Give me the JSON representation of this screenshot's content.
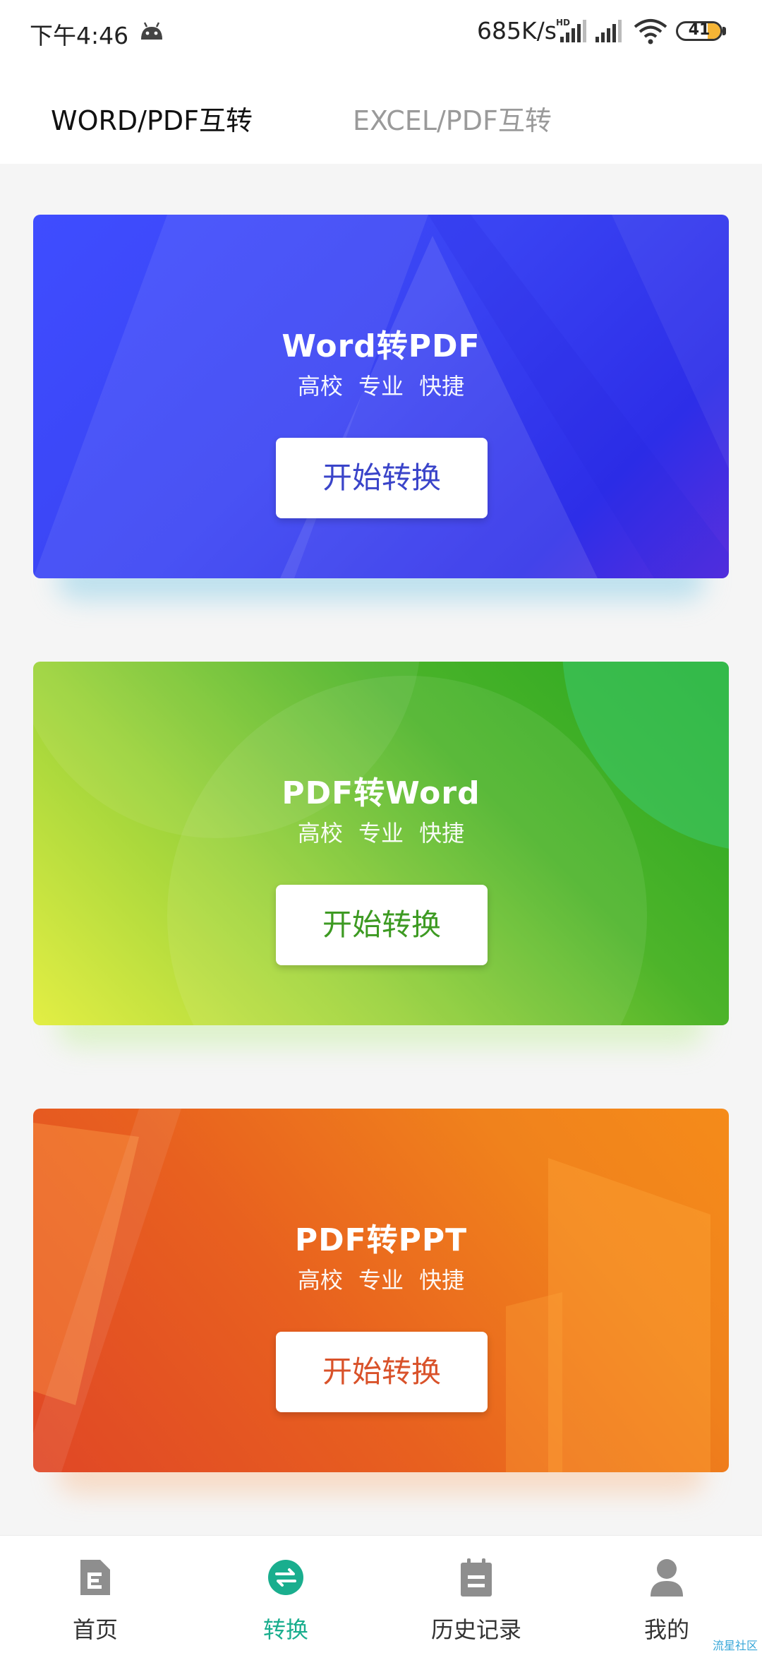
{
  "status_bar": {
    "time": "下午4:46",
    "net_speed": "685K/s",
    "battery": "41",
    "hd_label": "HD"
  },
  "tabs": [
    {
      "label": "WORD/PDF互转",
      "active": true
    },
    {
      "label": "EXCEL/PDF互转",
      "active": false
    }
  ],
  "cards": [
    {
      "title": "Word转PDF",
      "subtitle": "高校 专业 快捷",
      "button": "开始转换",
      "button_color": "#3a44c9"
    },
    {
      "title": "PDF转Word",
      "subtitle": "高校 专业 快捷",
      "button": "开始转换",
      "button_color": "#3d9a22"
    },
    {
      "title": "PDF转PPT",
      "subtitle": "高校 专业 快捷",
      "button": "开始转换",
      "button_color": "#d9522a"
    }
  ],
  "bottom_nav": [
    {
      "label": "首页",
      "icon": "home-document-icon",
      "active": false
    },
    {
      "label": "转换",
      "icon": "convert-swap-icon",
      "active": true
    },
    {
      "label": "历史记录",
      "icon": "history-calendar-icon",
      "active": false
    },
    {
      "label": "我的",
      "icon": "user-profile-icon",
      "active": false
    }
  ],
  "watermark": "流星社区",
  "colors": {
    "accent": "#1aae8e",
    "tab_inactive": "#9a9a9a",
    "icon_gray": "#8e8e8e"
  }
}
